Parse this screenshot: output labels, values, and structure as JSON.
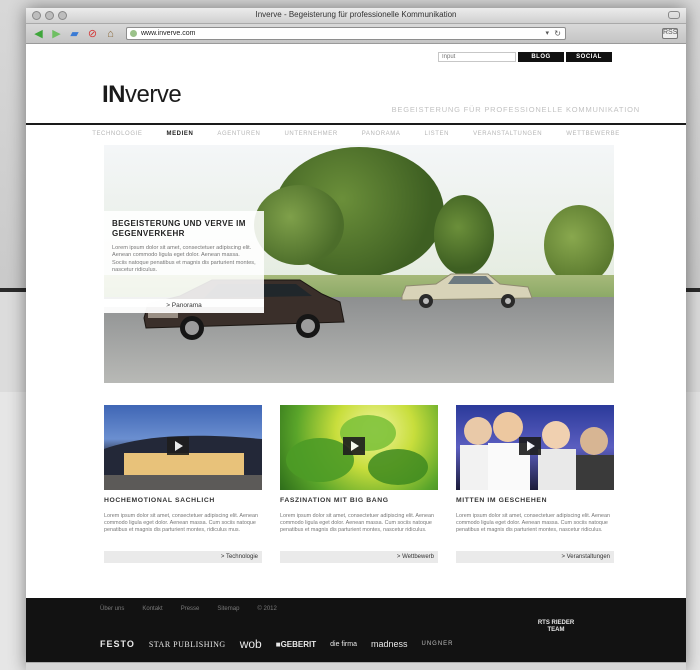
{
  "browser": {
    "window_title": "Inverve - Begeisterung für professionelle Kommunikation",
    "url": "www.inverve.com",
    "rss_label": "RSS"
  },
  "header": {
    "search_placeholder": "Input",
    "blog_label": "BLOG",
    "social_label": "SOCIAL",
    "logo_prefix": "IN",
    "logo_suffix": "verve",
    "tagline": "BEGEISTERUNG FÜR PROFESSIONELLE KOMMUNIKATION"
  },
  "nav": {
    "items": [
      "TECHNOLOGIE",
      "MEDIEN",
      "AGENTUREN",
      "UNTERNEHMER",
      "PANORAMA",
      "LISTEN",
      "VERANSTALTUNGEN",
      "WETTBEWERBE"
    ],
    "active_index": 1
  },
  "hero": {
    "title": "BEGEISTERUNG UND VERVE IM GEGENVERKEHR",
    "text": "Lorem ipsum dolor sit amet, consectetuer adipiscing elit. Aenean commodo ligula eget dolor. Aenean massa. Sociis natoque penatibus et magnis dis parturient montes, nascetur ridiculus.",
    "link_label": "> Panorama"
  },
  "features": [
    {
      "title": "HOCHEMOTIONAL SACHLICH",
      "text": "Lorem ipsum dolor sit amet, consectetuer adipiscing elit. Aenean commodo ligula eget dolor. Aenean massa. Cum sociis natoque penatibus et magnis dis parturient montes, ridiculus mus.",
      "link_label": "> Technologie"
    },
    {
      "title": "FASZINATION MIT BIG BANG",
      "text": "Lorem ipsum dolor sit amet, consectetuer adipiscing elit. Aenean commodo ligula eget dolor. Aenean massa. Cum sociis natoque penatibus et magnis dis parturient montes, nascetur ridiculus.",
      "link_label": "> Wettbewerb"
    },
    {
      "title": "MITTEN IM GESCHEHEN",
      "text": "Lorem ipsum dolor sit amet, consectetuer adipiscing elit. Aenean commodo ligula eget dolor. Aenean massa. Cum sociis natoque penatibus et magnis dis parturient montes, nascetur ridiculus.",
      "link_label": "> Veranstaltungen"
    }
  ],
  "footer": {
    "links": [
      "Über uns",
      "Kontakt",
      "Presse",
      "Sitemap",
      "© 2012"
    ],
    "logos": {
      "festo": "FESTO",
      "star": "STAR PUBLISHING",
      "wob": "wob",
      "geberit": "■GEBERIT",
      "firma": "die firma",
      "madness": "madness",
      "ungner": "UNGNER",
      "rts": "RTS RIEDER TEAM"
    }
  },
  "colors": {
    "footer_bg": "#121212",
    "accent_dark": "#111111"
  }
}
